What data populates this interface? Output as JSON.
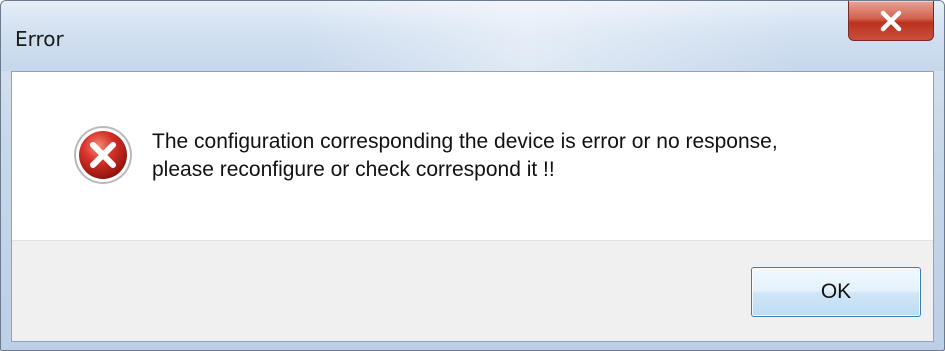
{
  "window": {
    "title": "Error",
    "close_icon": "close-x-icon"
  },
  "dialog": {
    "icon": "error-icon",
    "message_line1": "The configuration corresponding the device is error or no response,",
    "message_line2": "please reconfigure or check correspond it !!",
    "ok_label": "OK"
  },
  "colors": {
    "close_button": "#c9503a",
    "error_icon": "#c8241b",
    "ok_border": "#3c7fb1"
  }
}
